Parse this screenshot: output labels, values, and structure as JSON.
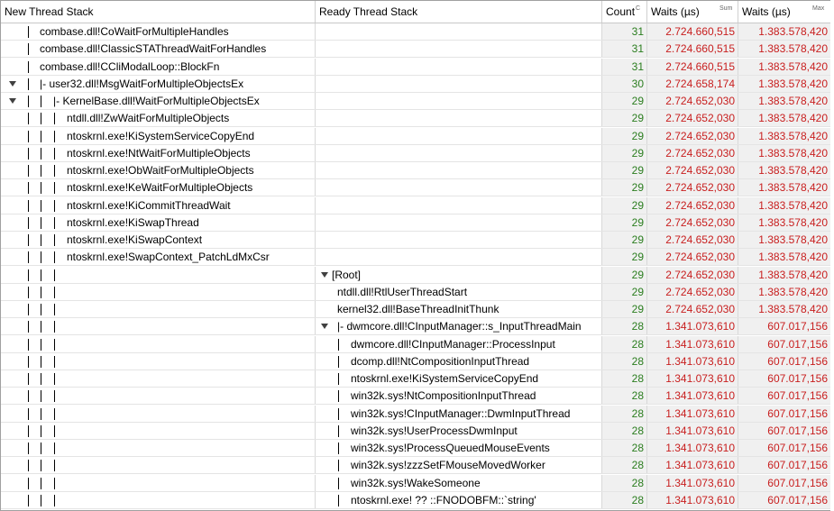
{
  "columns": {
    "new_thread_stack": "New Thread Stack",
    "ready_thread_stack": "Ready Thread Stack",
    "count": "Count",
    "count_sub": "C",
    "waits_sum": "Waits (µs)",
    "waits_sum_sub": "Sum",
    "waits_max": "Waits (µs)",
    "waits_max_sub": "Max"
  },
  "rows": [
    {
      "left": "combase.dll!CoWaitForMultipleHandles",
      "right": "",
      "count": "31",
      "sum": "2.724.660,515",
      "max": "1.383.578,420"
    },
    {
      "left": "combase.dll!ClassicSTAThreadWaitForHandles",
      "right": "",
      "count": "31",
      "sum": "2.724.660,515",
      "max": "1.383.578,420"
    },
    {
      "left": "combase.dll!CCliModalLoop::BlockFn",
      "right": "",
      "count": "31",
      "sum": "2.724.660,515",
      "max": "1.383.578,420"
    },
    {
      "left": "|- user32.dll!MsgWaitForMultipleObjectsEx",
      "right": "",
      "count": "30",
      "sum": "2.724.658,174",
      "max": "1.383.578,420"
    },
    {
      "left": "|- KernelBase.dll!WaitForMultipleObjectsEx",
      "right": "",
      "count": "29",
      "sum": "2.724.652,030",
      "max": "1.383.578,420"
    },
    {
      "left": "ntdll.dll!ZwWaitForMultipleObjects",
      "right": "",
      "count": "29",
      "sum": "2.724.652,030",
      "max": "1.383.578,420"
    },
    {
      "left": "ntoskrnl.exe!KiSystemServiceCopyEnd",
      "right": "",
      "count": "29",
      "sum": "2.724.652,030",
      "max": "1.383.578,420"
    },
    {
      "left": "ntoskrnl.exe!NtWaitForMultipleObjects",
      "right": "",
      "count": "29",
      "sum": "2.724.652,030",
      "max": "1.383.578,420"
    },
    {
      "left": "ntoskrnl.exe!ObWaitForMultipleObjects",
      "right": "",
      "count": "29",
      "sum": "2.724.652,030",
      "max": "1.383.578,420"
    },
    {
      "left": "ntoskrnl.exe!KeWaitForMultipleObjects",
      "right": "",
      "count": "29",
      "sum": "2.724.652,030",
      "max": "1.383.578,420"
    },
    {
      "left": "ntoskrnl.exe!KiCommitThreadWait",
      "right": "",
      "count": "29",
      "sum": "2.724.652,030",
      "max": "1.383.578,420"
    },
    {
      "left": "ntoskrnl.exe!KiSwapThread",
      "right": "",
      "count": "29",
      "sum": "2.724.652,030",
      "max": "1.383.578,420"
    },
    {
      "left": "ntoskrnl.exe!KiSwapContext",
      "right": "",
      "count": "29",
      "sum": "2.724.652,030",
      "max": "1.383.578,420"
    },
    {
      "left": "ntoskrnl.exe!SwapContext_PatchLdMxCsr",
      "right": "",
      "count": "29",
      "sum": "2.724.652,030",
      "max": "1.383.578,420"
    },
    {
      "left": "",
      "right": "[Root]",
      "count": "29",
      "sum": "2.724.652,030",
      "max": "1.383.578,420"
    },
    {
      "left": "",
      "right": "ntdll.dll!RtlUserThreadStart",
      "count": "29",
      "sum": "2.724.652,030",
      "max": "1.383.578,420"
    },
    {
      "left": "",
      "right": "kernel32.dll!BaseThreadInitThunk",
      "count": "29",
      "sum": "2.724.652,030",
      "max": "1.383.578,420"
    },
    {
      "left": "",
      "right": "|- dwmcore.dll!CInputManager::s_InputThreadMain",
      "count": "28",
      "sum": "1.341.073,610",
      "max": "607.017,156"
    },
    {
      "left": "",
      "right": "dwmcore.dll!CInputManager::ProcessInput",
      "count": "28",
      "sum": "1.341.073,610",
      "max": "607.017,156"
    },
    {
      "left": "",
      "right": "dcomp.dll!NtCompositionInputThread",
      "count": "28",
      "sum": "1.341.073,610",
      "max": "607.017,156"
    },
    {
      "left": "",
      "right": "ntoskrnl.exe!KiSystemServiceCopyEnd",
      "count": "28",
      "sum": "1.341.073,610",
      "max": "607.017,156"
    },
    {
      "left": "",
      "right": "win32k.sys!NtCompositionInputThread",
      "count": "28",
      "sum": "1.341.073,610",
      "max": "607.017,156"
    },
    {
      "left": "",
      "right": "win32k.sys!CInputManager::DwmInputThread",
      "count": "28",
      "sum": "1.341.073,610",
      "max": "607.017,156"
    },
    {
      "left": "",
      "right": "win32k.sys!UserProcessDwmInput",
      "count": "28",
      "sum": "1.341.073,610",
      "max": "607.017,156"
    },
    {
      "left": "",
      "right": "win32k.sys!ProcessQueuedMouseEvents",
      "count": "28",
      "sum": "1.341.073,610",
      "max": "607.017,156"
    },
    {
      "left": "",
      "right": "win32k.sys!zzzSetFMouseMovedWorker",
      "count": "28",
      "sum": "1.341.073,610",
      "max": "607.017,156"
    },
    {
      "left": "",
      "right": "win32k.sys!WakeSomeone",
      "count": "28",
      "sum": "1.341.073,610",
      "max": "607.017,156"
    },
    {
      "left": "",
      "right": "ntoskrnl.exe! ?? ::FNODOBFM::`string'",
      "count": "28",
      "sum": "1.341.073,610",
      "max": "607.017,156"
    }
  ]
}
